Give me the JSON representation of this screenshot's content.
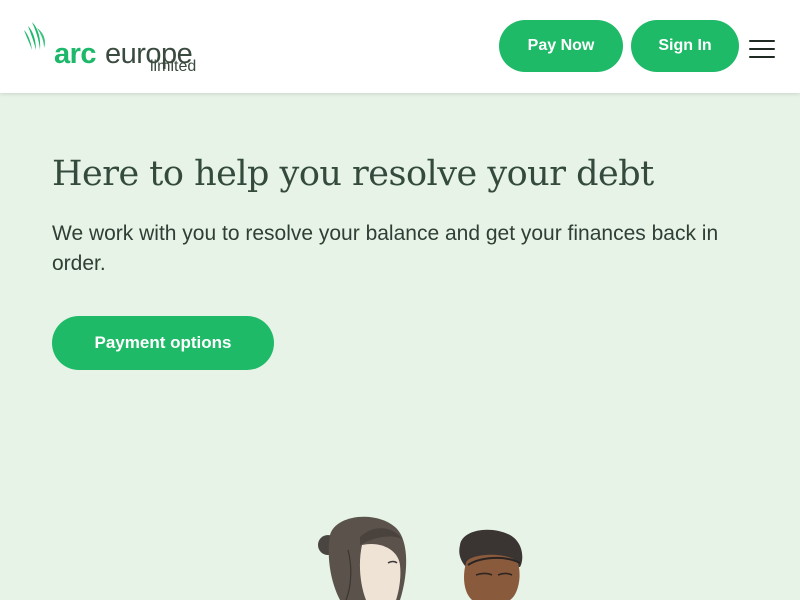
{
  "brand": {
    "name_bold": "arc",
    "name_light": "europe",
    "suffix": "limited"
  },
  "header": {
    "pay_now_label": "Pay Now",
    "sign_in_label": "Sign In"
  },
  "hero": {
    "title": "Here to help you resolve your debt",
    "subtitle": "We work with you to resolve your balance and get your finances back in order.",
    "cta_label": "Payment options"
  },
  "colors": {
    "accent": "#1fba68",
    "hero_background": "#e6f3e6",
    "heading_text": "#334a3d"
  },
  "icons": [
    "arc-leaf-logo-icon",
    "hamburger-menu-icon"
  ]
}
